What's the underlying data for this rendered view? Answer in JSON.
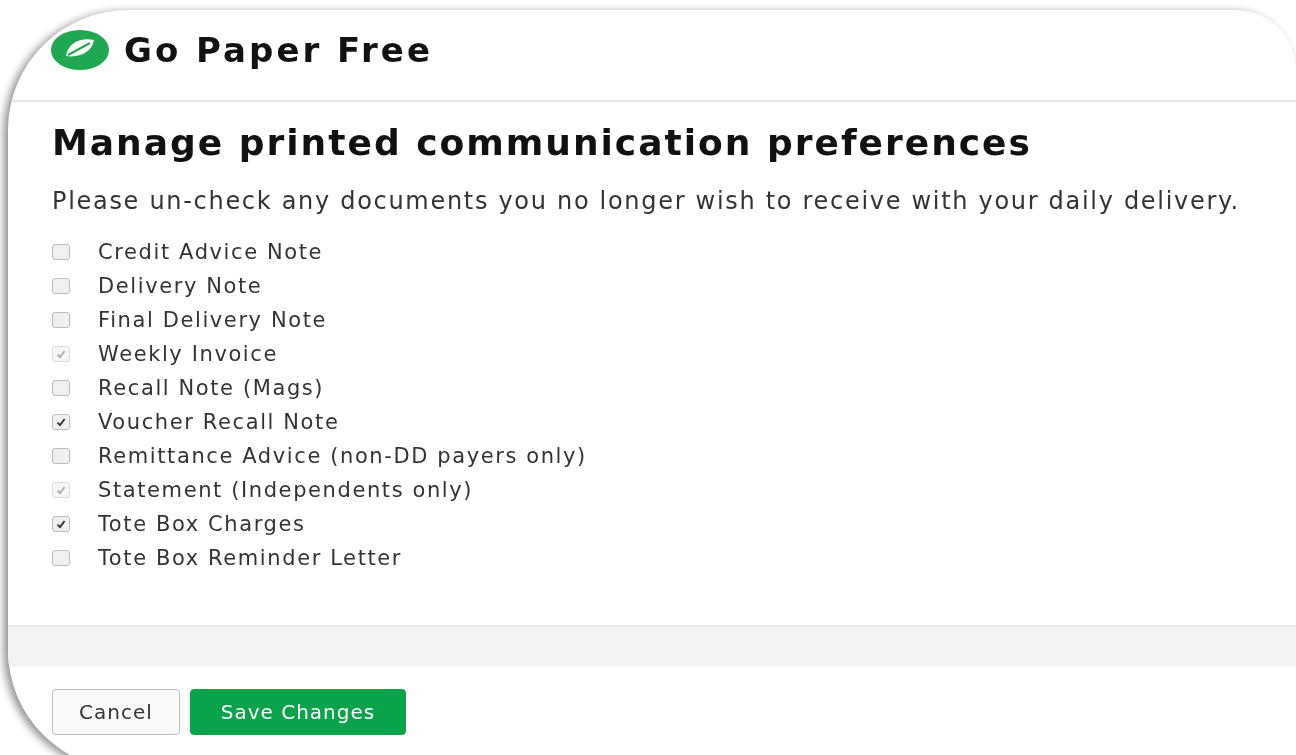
{
  "brand": {
    "title": "Go Paper Free"
  },
  "heading": "Manage printed communication preferences",
  "instructions": "Please un-check any documents you no longer wish to receive with your daily delivery.",
  "documents": [
    {
      "label": "Credit Advice Note",
      "checked": false,
      "disabled": false
    },
    {
      "label": "Delivery Note",
      "checked": false,
      "disabled": false
    },
    {
      "label": "Final Delivery Note",
      "checked": false,
      "disabled": false
    },
    {
      "label": "Weekly Invoice",
      "checked": true,
      "disabled": true
    },
    {
      "label": "Recall Note (Mags)",
      "checked": false,
      "disabled": false
    },
    {
      "label": "Voucher Recall Note",
      "checked": true,
      "disabled": false
    },
    {
      "label": "Remittance Advice (non-DD payers only)",
      "checked": false,
      "disabled": false
    },
    {
      "label": "Statement (Independents only)",
      "checked": true,
      "disabled": true
    },
    {
      "label": "Tote Box Charges",
      "checked": true,
      "disabled": false
    },
    {
      "label": "Tote Box Reminder Letter",
      "checked": false,
      "disabled": false
    }
  ],
  "buttons": [
    {
      "label": "Cancel",
      "kind": "secondary"
    },
    {
      "label": "Save Changes",
      "kind": "primary"
    }
  ]
}
